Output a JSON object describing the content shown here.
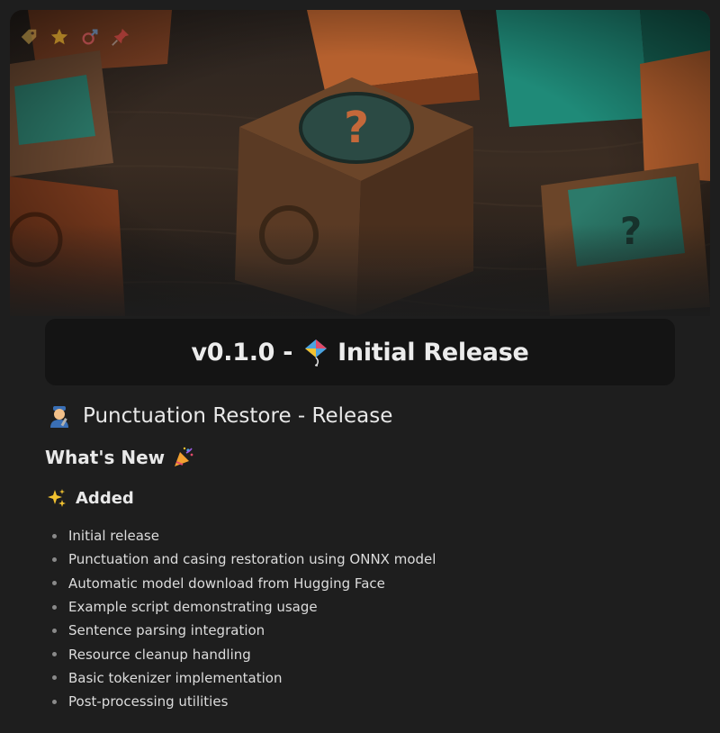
{
  "hero": {
    "image": "wooden-question-dice",
    "icons": [
      "tag-icon",
      "star-icon",
      "gender-icon",
      "pin-icon"
    ]
  },
  "banner": {
    "version": "v0.1.0 -",
    "emoji": "kite-icon",
    "title": "Initial Release"
  },
  "project_title": {
    "emoji": "mechanic-icon",
    "text": "Punctuation Restore - Release"
  },
  "whats_new": {
    "text": "What's New",
    "emoji": "party-popper-icon"
  },
  "added": {
    "emoji": "sparkles-icon",
    "text": "Added"
  },
  "items": [
    "Initial release",
    "Punctuation and casing restoration using ONNX model",
    "Automatic model download from Hugging Face",
    "Example script demonstrating usage",
    "Sentence parsing integration",
    "Resource cleanup handling",
    "Basic tokenizer implementation",
    "Post-processing utilities"
  ],
  "colors": {
    "background": "#1e1e1e",
    "banner": "#141414",
    "text": "#e6e6e6"
  }
}
